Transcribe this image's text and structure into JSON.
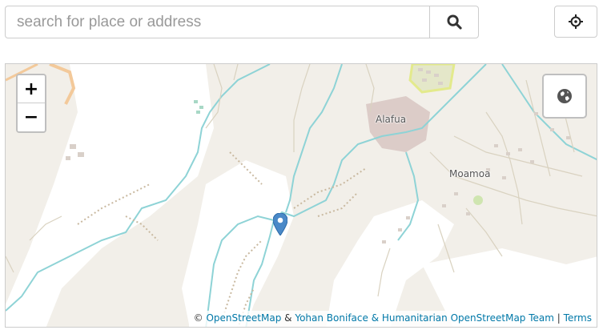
{
  "search": {
    "placeholder": "search for place or address",
    "button_icon": "search-icon"
  },
  "locate_button": {
    "icon": "crosshair-icon"
  },
  "map": {
    "zoom_in_label": "+",
    "zoom_out_label": "−",
    "layer_button_icon": "globe-icon",
    "place_labels": {
      "alafua": "Alafua",
      "moamoa": "Moamoa"
    },
    "marker_icon": "map-pin-icon",
    "attribution": {
      "copyright": "©",
      "osm_link": "OpenStreetMap",
      "ampersand": "&",
      "hot_link": "Yohan Boniface & Humanitarian OpenStreetMap Team",
      "separator": "|",
      "terms_link": "Terms"
    }
  },
  "colors": {
    "land": "#f2efe9",
    "river": "#8ed3d6",
    "residential": "#dcccc8",
    "park": "#c7dfa9",
    "marker": "#4a89c8",
    "link": "#0078a8"
  }
}
